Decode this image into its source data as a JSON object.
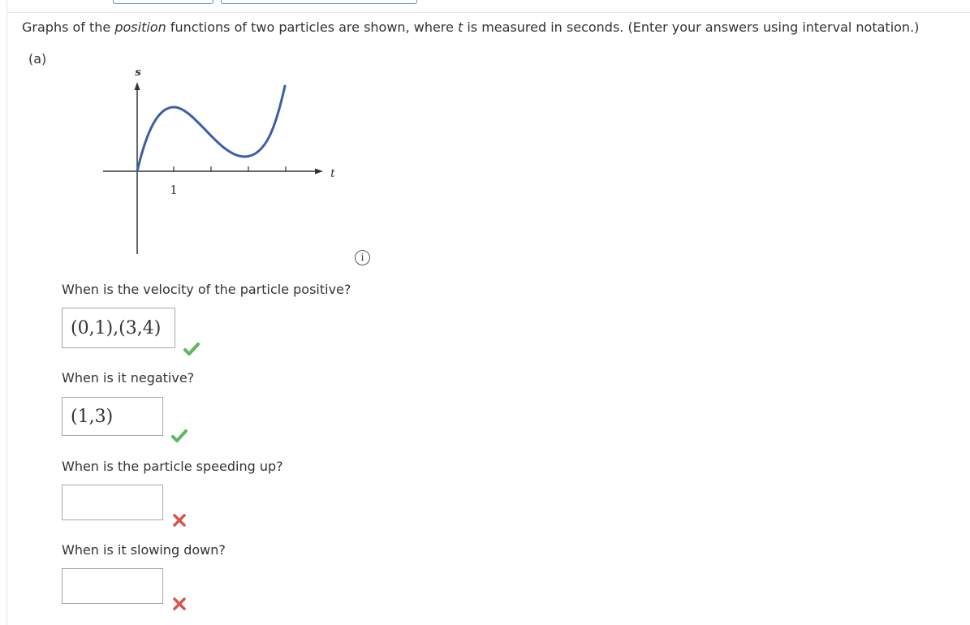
{
  "prompt": {
    "before": "Graphs of the ",
    "emph": "position",
    "middle": " functions of two particles are shown, where ",
    "var": "t",
    "after": " is measured in seconds. (Enter your answers using interval notation.)"
  },
  "part": {
    "label": "(a)"
  },
  "graph": {
    "s_label": "s",
    "t_label": "t",
    "tick_label": "1"
  },
  "questions": [
    {
      "text": "When is the velocity of the particle positive?",
      "answer": "(0,1),(3,4)",
      "status": "correct"
    },
    {
      "text": "When is it negative?",
      "answer": "(1,3)",
      "status": "correct"
    },
    {
      "text": "When is the particle speeding up?",
      "answer": "",
      "status": "incorrect"
    },
    {
      "text": "When is it slowing down?",
      "answer": "",
      "status": "incorrect"
    }
  ],
  "icons": {
    "info": "info-icon",
    "correct": "check-icon",
    "incorrect": "x-icon"
  },
  "colors": {
    "curve": "#3a5fa8",
    "correct": "#5cb85c",
    "incorrect": "#d9534f"
  }
}
